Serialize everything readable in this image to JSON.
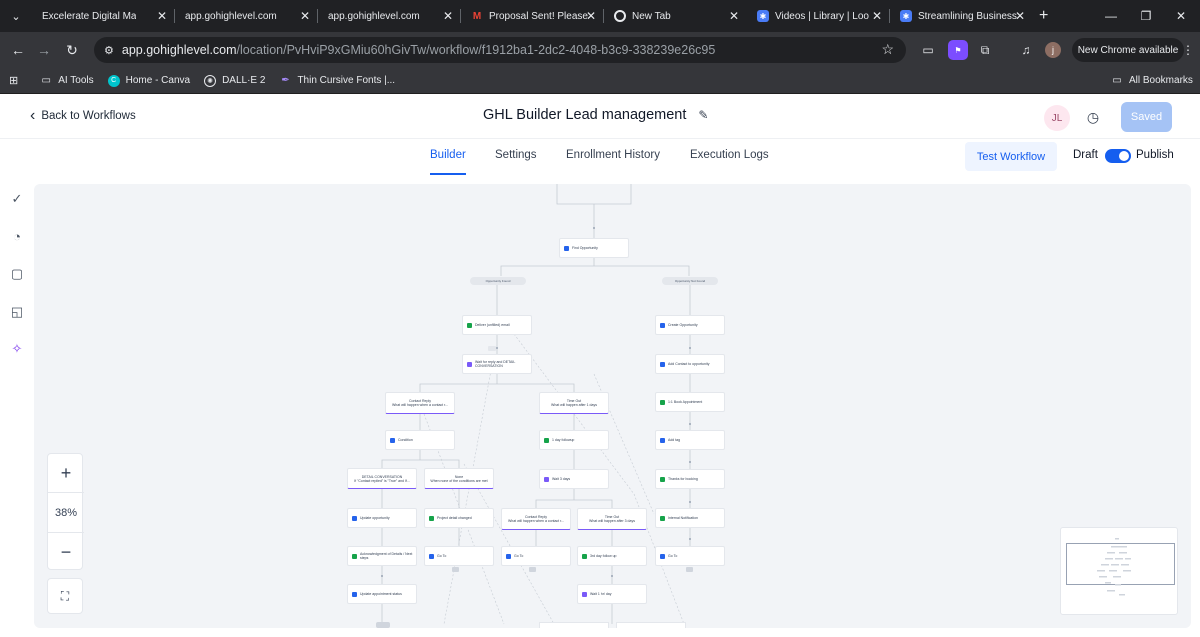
{
  "browser": {
    "tabs": [
      {
        "title": "Excelerate Digital Ma",
        "icon": "ghl-icon",
        "active": false
      },
      {
        "title": "app.gohighlevel.com",
        "icon": "ghl-icon",
        "active": false
      },
      {
        "title": "app.gohighlevel.com",
        "icon": "ghl-icon",
        "active": true
      },
      {
        "title": "Proposal Sent! Please",
        "icon": "gmail-icon",
        "active": false
      },
      {
        "title": "New Tab",
        "icon": "chrome-icon",
        "active": false
      },
      {
        "title": "Videos | Library | Loo",
        "icon": "gear-icon",
        "active": false
      },
      {
        "title": "Streamlining Business",
        "icon": "gear-icon",
        "active": false
      }
    ],
    "address": {
      "host": "app.gohighlevel.com",
      "path": "/location/PvHviP9xGMiu60hGivTw/workflow/f1912ba1-2dc2-4048-b3c9-338239e26c95"
    },
    "new_chrome_label": "New Chrome available",
    "profile_initial": "j",
    "bookmarks": [
      {
        "label": "AI Tools",
        "icon": "folder-icon"
      },
      {
        "label": "Home - Canva",
        "icon": "canva-icon"
      },
      {
        "label": "DALL·E 2",
        "icon": "openai-icon"
      },
      {
        "label": "Thin Cursive Fonts |...",
        "icon": "font-icon"
      }
    ],
    "all_bookmarks_label": "All Bookmarks"
  },
  "header": {
    "back_label": "Back to Workflows",
    "title": "GHL Builder Lead management",
    "avatar_initials": "JL",
    "saved_label": "Saved"
  },
  "tabs": {
    "builder": "Builder",
    "settings": "Settings",
    "enrollment": "Enrollment History",
    "logs": "Execution Logs",
    "test_label": "Test Workflow",
    "draft_label": "Draft",
    "publish_label": "Publish"
  },
  "zoom": {
    "level": "38%",
    "plus": "+",
    "minus": "−"
  },
  "canvas": {
    "pills": {
      "found": "Opportunity Found",
      "not_found": "Opportunity Not Found"
    },
    "nodes": {
      "find": "Find Opportunity",
      "create_opp": "Create Opportunity",
      "deliver": "Deliver (unfilled) email",
      "add_to_opp": "Add Contact to opportunity",
      "wait_reply": "Wait for reply and DETAIL CONVERSATION",
      "appt": "1:1 Book Appointment",
      "contact_reply_title": "Contact Reply",
      "contact_reply_sub": "What will happen when a contact r...",
      "timeout_title": "Time Out",
      "timeout_sub": "What will happen after 1 days",
      "add_tag": "Add tag",
      "condition": "Condition",
      "followup": "1 day followup",
      "thanks": "Thanks for booking",
      "detail_title": "DETAIL CONVERSATION",
      "detail_sub": "If \"Contact replied\" is \"True\" and If...",
      "none_title": "None",
      "none_sub": "When none of the conditions are met",
      "wait3": "Wait 3 days",
      "internal": "Internal Notification",
      "update_opp": "Update opportunity",
      "project": "Project detail changed",
      "contact_reply2_title": "Contact Reply",
      "contact_reply2_sub": "What will happen when a contact r...",
      "timeout2_title": "Time Out",
      "timeout2_sub": "What will happen after 3 days",
      "ack": "Acknowledgment of Details / Next steps",
      "goto1": "Go To",
      "goto2": "Go To",
      "followup3": "3rd day follow up",
      "goto3": "Go To",
      "update_appt": "Update appointment status",
      "wait1": "Wait 1 hr/ day"
    }
  },
  "colors": {
    "accent": "#155eef",
    "canvas_bg": "#f2f4f7",
    "node_green": "#16a34a",
    "node_purple": "#7a5af8",
    "node_blue": "#2563eb"
  }
}
